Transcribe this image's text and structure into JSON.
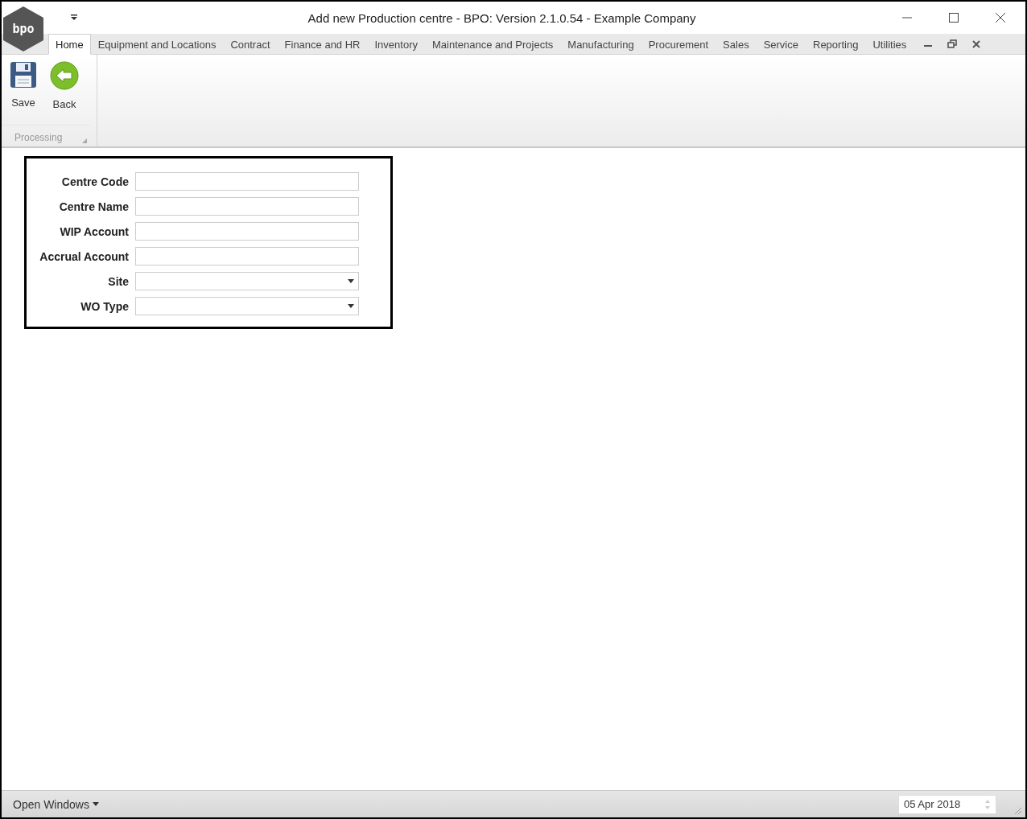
{
  "window": {
    "title": "Add new Production centre - BPO: Version 2.1.0.54 - Example Company",
    "logo_text": "bpo"
  },
  "tabs": [
    {
      "label": "Home",
      "selected": true
    },
    {
      "label": "Equipment and Locations",
      "selected": false
    },
    {
      "label": "Contract",
      "selected": false
    },
    {
      "label": "Finance and HR",
      "selected": false
    },
    {
      "label": "Inventory",
      "selected": false
    },
    {
      "label": "Maintenance and Projects",
      "selected": false
    },
    {
      "label": "Manufacturing",
      "selected": false
    },
    {
      "label": "Procurement",
      "selected": false
    },
    {
      "label": "Sales",
      "selected": false
    },
    {
      "label": "Service",
      "selected": false
    },
    {
      "label": "Reporting",
      "selected": false
    },
    {
      "label": "Utilities",
      "selected": false
    }
  ],
  "ribbon": {
    "groups": [
      {
        "label": "Processing",
        "buttons": [
          {
            "label": "Save",
            "kind": "save"
          },
          {
            "label": "Back",
            "kind": "back"
          }
        ]
      }
    ]
  },
  "form": {
    "fields": [
      {
        "label": "Centre Code",
        "kind": "text"
      },
      {
        "label": "Centre Name",
        "kind": "text"
      },
      {
        "label": "WIP Account",
        "kind": "text"
      },
      {
        "label": "Accrual Account",
        "kind": "text"
      },
      {
        "label": "Site",
        "kind": "dropdown"
      },
      {
        "label": "WO Type",
        "kind": "dropdown"
      }
    ]
  },
  "status_bar": {
    "open_windows": "Open Windows",
    "date": "05 Apr 2018"
  }
}
